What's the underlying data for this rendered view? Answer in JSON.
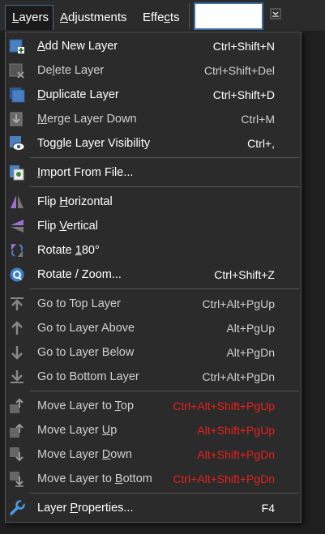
{
  "menubar": {
    "tabs": [
      {
        "label": "Layers",
        "underline": "L",
        "rest": "ayers"
      },
      {
        "label": "Adjustments",
        "underline": "A",
        "rest": "djustments"
      },
      {
        "label": "Effects",
        "pre": "Effe",
        "underline": "c",
        "rest": "ts"
      }
    ]
  },
  "menu": {
    "items": [
      {
        "pre": "",
        "u": "A",
        "post": "dd New Layer",
        "shortcut": "Ctrl+Shift+N",
        "icon": "add-layer-icon"
      },
      {
        "pre": "De",
        "u": "l",
        "post": "ete Layer",
        "shortcut": "Ctrl+Shift+Del",
        "icon": "delete-layer-icon"
      },
      {
        "pre": "",
        "u": "D",
        "post": "uplicate Layer",
        "shortcut": "Ctrl+Shift+D",
        "icon": "duplicate-layer-icon"
      },
      {
        "pre": "",
        "u": "M",
        "post": "erge Layer Down",
        "shortcut": "Ctrl+M",
        "icon": "merge-layer-icon"
      },
      {
        "pre": "Toggle Layer Visibility",
        "u": "",
        "post": "",
        "shortcut": "Ctrl+,",
        "icon": "eye-icon"
      },
      {
        "pre": "",
        "u": "I",
        "post": "mport From File...",
        "shortcut": "",
        "icon": "import-file-icon"
      },
      {
        "pre": "Flip ",
        "u": "H",
        "post": "orizontal",
        "shortcut": "",
        "icon": "flip-horizontal-icon"
      },
      {
        "pre": "Flip ",
        "u": "V",
        "post": "ertical",
        "shortcut": "",
        "icon": "flip-vertical-icon"
      },
      {
        "pre": "Rotate ",
        "u": "1",
        "post": "80°",
        "shortcut": "",
        "icon": "rotate-180-icon"
      },
      {
        "pre": "Rotate / Zoom...",
        "u": "",
        "post": "",
        "shortcut": "Ctrl+Shift+Z",
        "icon": "rotate-zoom-icon"
      },
      {
        "pre": "Go to Top Layer",
        "u": "",
        "post": "",
        "shortcut": "Ctrl+Alt+PgUp",
        "icon": "go-top-icon"
      },
      {
        "pre": "Go to Layer Above",
        "u": "",
        "post": "",
        "shortcut": "Alt+PgUp",
        "icon": "go-up-icon"
      },
      {
        "pre": "Go to Layer Below",
        "u": "",
        "post": "",
        "shortcut": "Alt+PgDn",
        "icon": "go-down-icon"
      },
      {
        "pre": "Go to Bottom Layer",
        "u": "",
        "post": "",
        "shortcut": "Ctrl+Alt+PgDn",
        "icon": "go-bottom-icon"
      },
      {
        "pre": "Move Layer to ",
        "u": "T",
        "post": "op",
        "shortcut": "Ctrl+Alt+Shift+PgUp",
        "icon": "move-top-icon"
      },
      {
        "pre": "Move Layer ",
        "u": "U",
        "post": "p",
        "shortcut": "Alt+Shift+PgUp",
        "icon": "move-up-icon"
      },
      {
        "pre": "Move Layer ",
        "u": "D",
        "post": "own",
        "shortcut": "Alt+Shift+PgDn",
        "icon": "move-down-icon"
      },
      {
        "pre": "Move Layer to ",
        "u": "B",
        "post": "ottom",
        "shortcut": "Ctrl+Alt+Shift+PgDn",
        "icon": "move-bottom-icon"
      },
      {
        "pre": "Layer ",
        "u": "P",
        "post": "roperties...",
        "shortcut": "F4",
        "icon": "wrench-icon"
      }
    ]
  },
  "colors": {
    "shortcut_red": "#e8201c",
    "menu_bg": "#2b2b2b",
    "accent": "#3a6ea5"
  }
}
